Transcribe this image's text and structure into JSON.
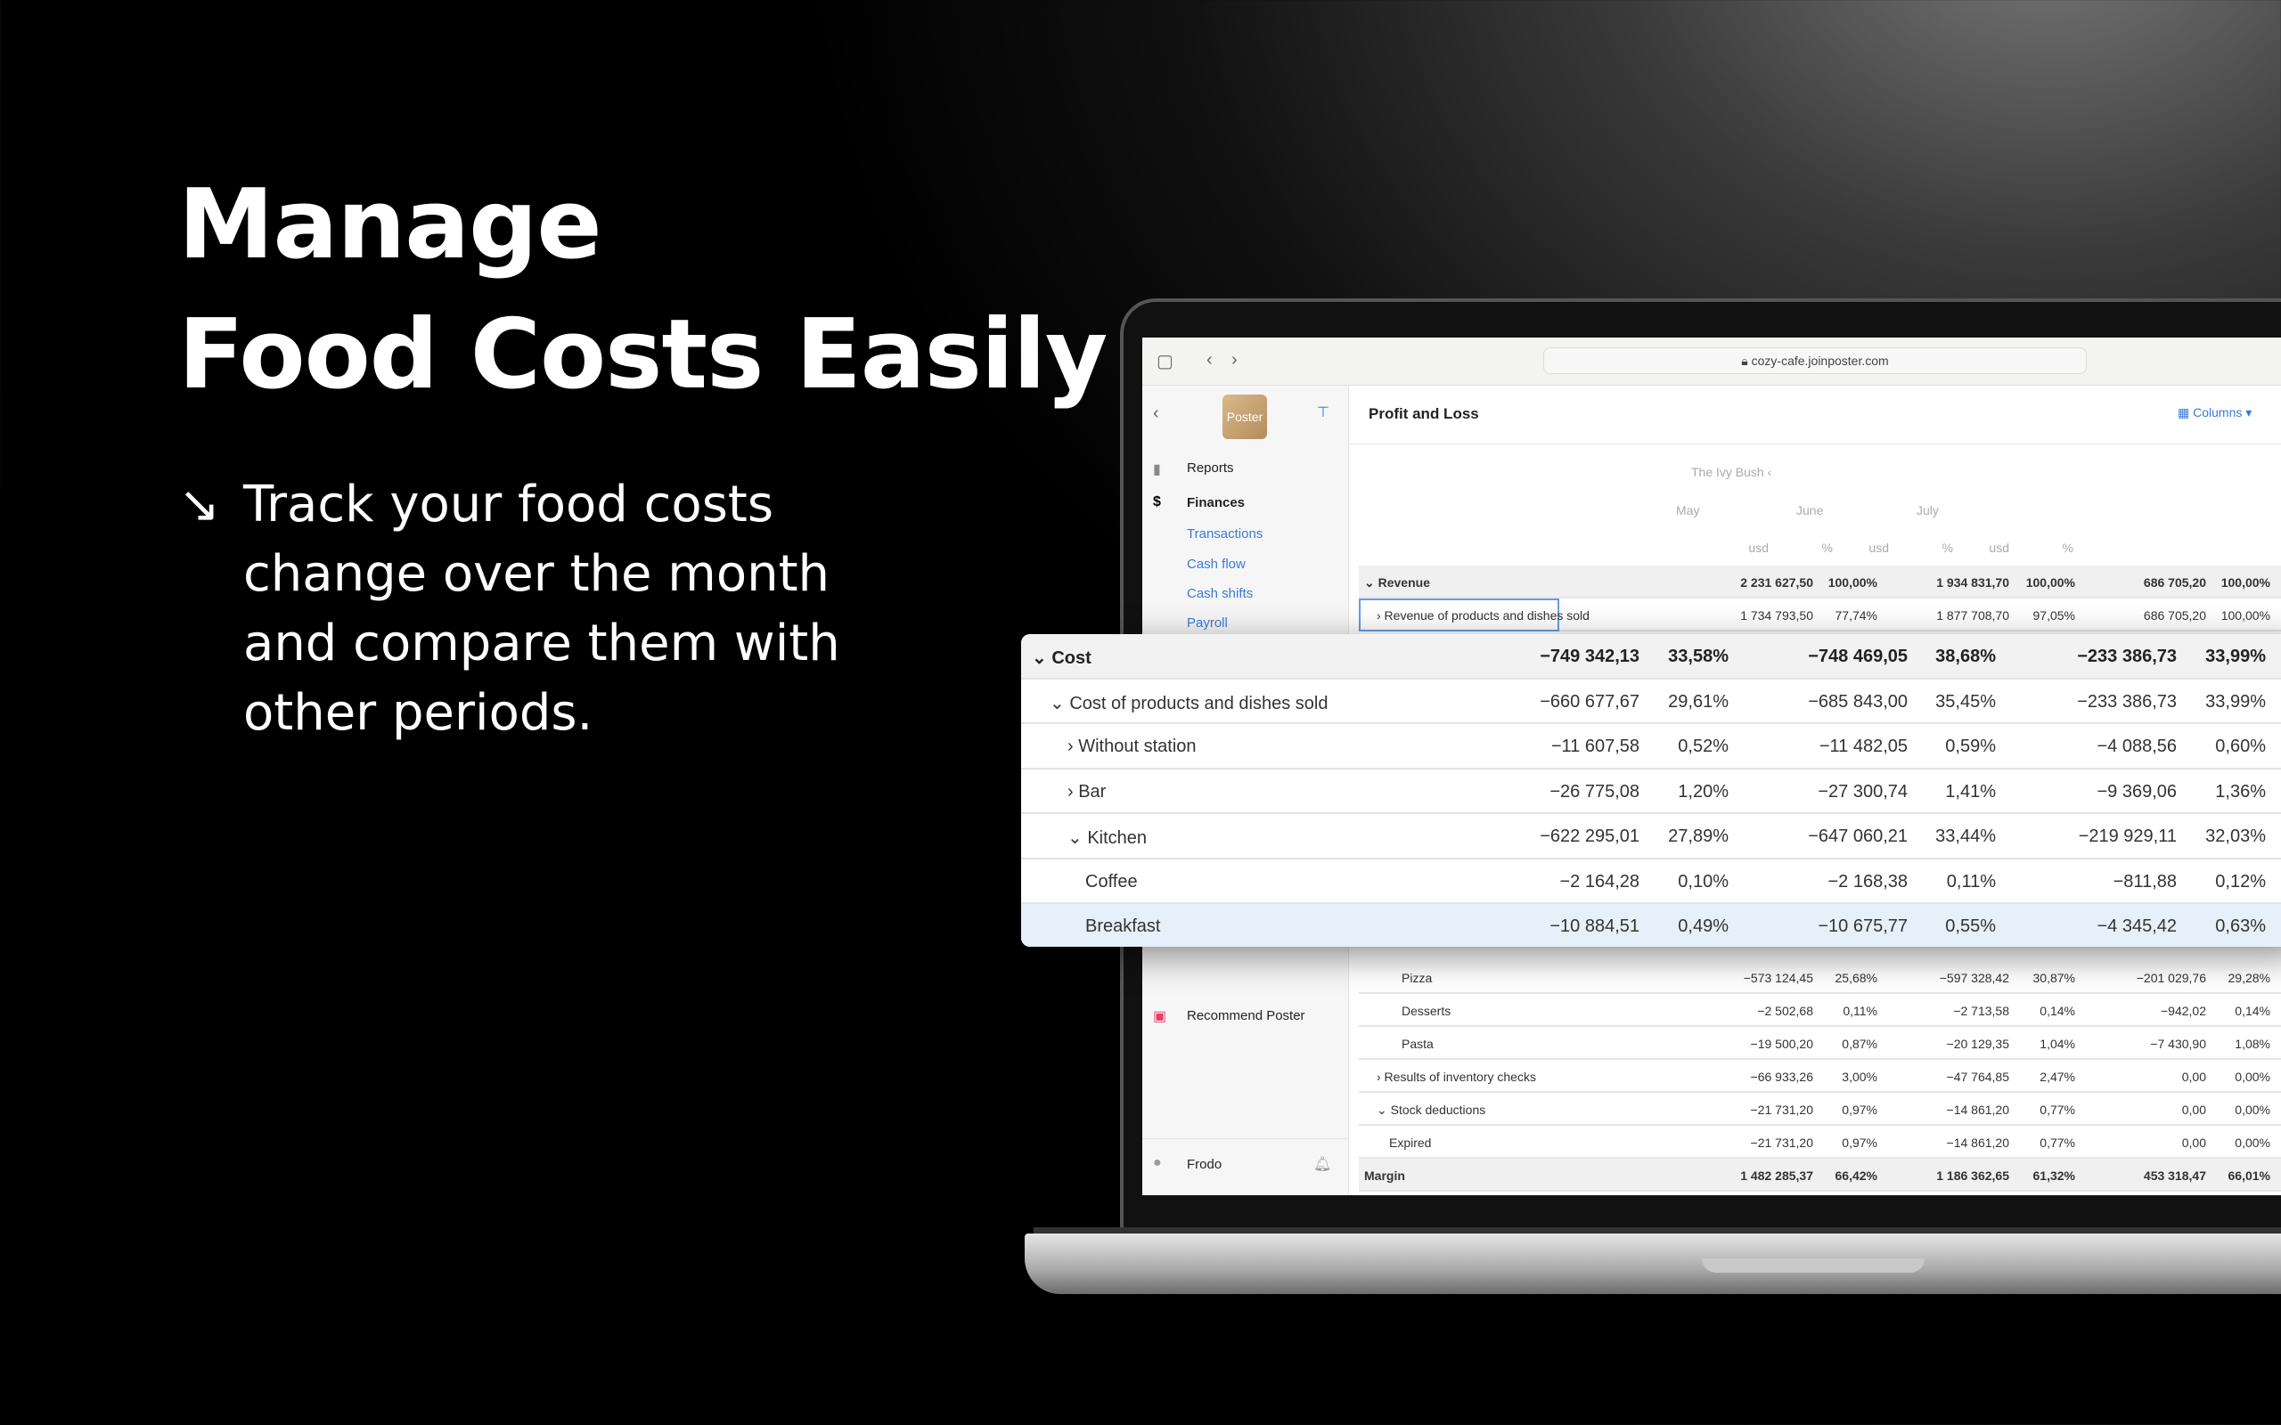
{
  "hero": {
    "line1": "Manage",
    "line2": "Food Costs Easily",
    "bullet_icon": "arrow-down-right-icon",
    "bullet": "Track your food costs change over the month and compare them with other periods."
  },
  "browser": {
    "url": "cozy-cafe.joinposter.com"
  },
  "sidebar": {
    "logo": "Poster",
    "items": [
      {
        "label": "Reports",
        "icon": "bar-chart-icon"
      },
      {
        "label": "Finances",
        "icon": "dollar-icon"
      }
    ],
    "sub_items": [
      "Transactions",
      "Cash flow",
      "Cash shifts",
      "Payroll"
    ],
    "recommend": "Recommend Poster",
    "user": "Frodo"
  },
  "header": {
    "title": "Profit and Loss",
    "columns_button": "Columns"
  },
  "table": {
    "establishment": "The Ivy Bush",
    "months": [
      "May",
      "June",
      "July"
    ],
    "unit": "usd",
    "pct": "%",
    "top_rows": [
      {
        "label": "Revenue",
        "bold": true,
        "indent": 0,
        "chev": "v",
        "v": [
          "2 231 627,50",
          "100,00%",
          "1 934 831,70",
          "100,00%",
          "686 705,20",
          "100,00%"
        ]
      },
      {
        "label": "Revenue of products and dishes sold",
        "indent": 1,
        "chev": ">",
        "v": [
          "1 734 793,50",
          "77,74%",
          "1 877 708,70",
          "97,05%",
          "686 705,20",
          "100,00%"
        ]
      }
    ],
    "bottom_rows": [
      {
        "label": "Pizza",
        "indent": 3,
        "v": [
          "−573 124,45",
          "25,68%",
          "−597 328,42",
          "30,87%",
          "−201 029,76",
          "29,28%"
        ]
      },
      {
        "label": "Desserts",
        "indent": 3,
        "v": [
          "−2 502,68",
          "0,11%",
          "−2 713,58",
          "0,14%",
          "−942,02",
          "0,14%"
        ]
      },
      {
        "label": "Pasta",
        "indent": 3,
        "v": [
          "−19 500,20",
          "0,87%",
          "−20 129,35",
          "1,04%",
          "−7 430,90",
          "1,08%"
        ]
      },
      {
        "label": "Results of inventory checks",
        "indent": 1,
        "chev": ">",
        "v": [
          "−66 933,26",
          "3,00%",
          "−47 764,85",
          "2,47%",
          "0,00",
          "0,00%"
        ]
      },
      {
        "label": "Stock deductions",
        "indent": 1,
        "chev": "v",
        "v": [
          "−21 731,20",
          "0,97%",
          "−14 861,20",
          "0,77%",
          "0,00",
          "0,00%"
        ]
      },
      {
        "label": "Expired",
        "indent": 2,
        "v": [
          "−21 731,20",
          "0,97%",
          "−14 861,20",
          "0,77%",
          "0,00",
          "0,00%"
        ]
      },
      {
        "label": "Margin",
        "bold": true,
        "indent": 0,
        "v": [
          "1 482 285,37",
          "66,42%",
          "1 186 362,65",
          "61,32%",
          "453 318,47",
          "66,01%"
        ]
      }
    ]
  },
  "card": {
    "rows": [
      {
        "label": "Cost",
        "indent": 0,
        "chev": "v",
        "v": [
          "−749 342,13",
          "33,58%",
          "−748 469,05",
          "38,68%",
          "−233 386,73",
          "33,99%"
        ]
      },
      {
        "label": "Cost of products and dishes sold",
        "indent": 1,
        "chev": "v",
        "v": [
          "−660 677,67",
          "29,61%",
          "−685 843,00",
          "35,45%",
          "−233 386,73",
          "33,99%"
        ]
      },
      {
        "label": "Without station",
        "indent": 2,
        "chev": ">",
        "v": [
          "−11 607,58",
          "0,52%",
          "−11 482,05",
          "0,59%",
          "−4 088,56",
          "0,60%"
        ]
      },
      {
        "label": "Bar",
        "indent": 2,
        "chev": ">",
        "v": [
          "−26 775,08",
          "1,20%",
          "−27 300,74",
          "1,41%",
          "−9 369,06",
          "1,36%"
        ]
      },
      {
        "label": "Kitchen",
        "indent": 2,
        "chev": "v",
        "v": [
          "−622 295,01",
          "27,89%",
          "−647 060,21",
          "33,44%",
          "−219 929,11",
          "32,03%"
        ]
      },
      {
        "label": "Coffee",
        "indent": 3,
        "v": [
          "−2 164,28",
          "0,10%",
          "−2 168,38",
          "0,11%",
          "−811,88",
          "0,12%"
        ]
      },
      {
        "label": "Breakfast",
        "indent": 3,
        "selected": true,
        "v": [
          "−10 884,51",
          "0,49%",
          "−10 675,77",
          "0,55%",
          "−4 345,42",
          "0,63%"
        ]
      }
    ]
  }
}
